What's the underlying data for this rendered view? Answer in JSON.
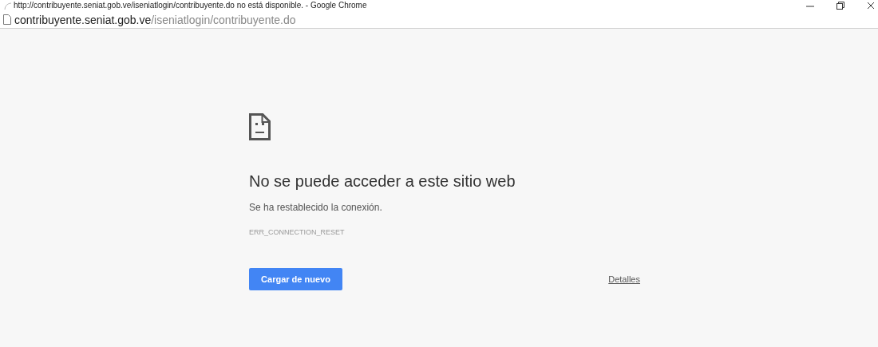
{
  "window": {
    "title": "http://contribuyente.seniat.gob.ve/iseniatlogin/contribuyente.do no está disponible. - Google Chrome"
  },
  "address_bar": {
    "host": "contribuyente.seniat.gob.ve",
    "path": "/iseniatlogin/contribuyente.do"
  },
  "error": {
    "heading": "No se puede acceder a este sitio web",
    "message": "Se ha restablecido la conexión.",
    "code": "ERR_CONNECTION_RESET"
  },
  "buttons": {
    "reload": "Cargar de nuevo",
    "details": "Detalles"
  }
}
